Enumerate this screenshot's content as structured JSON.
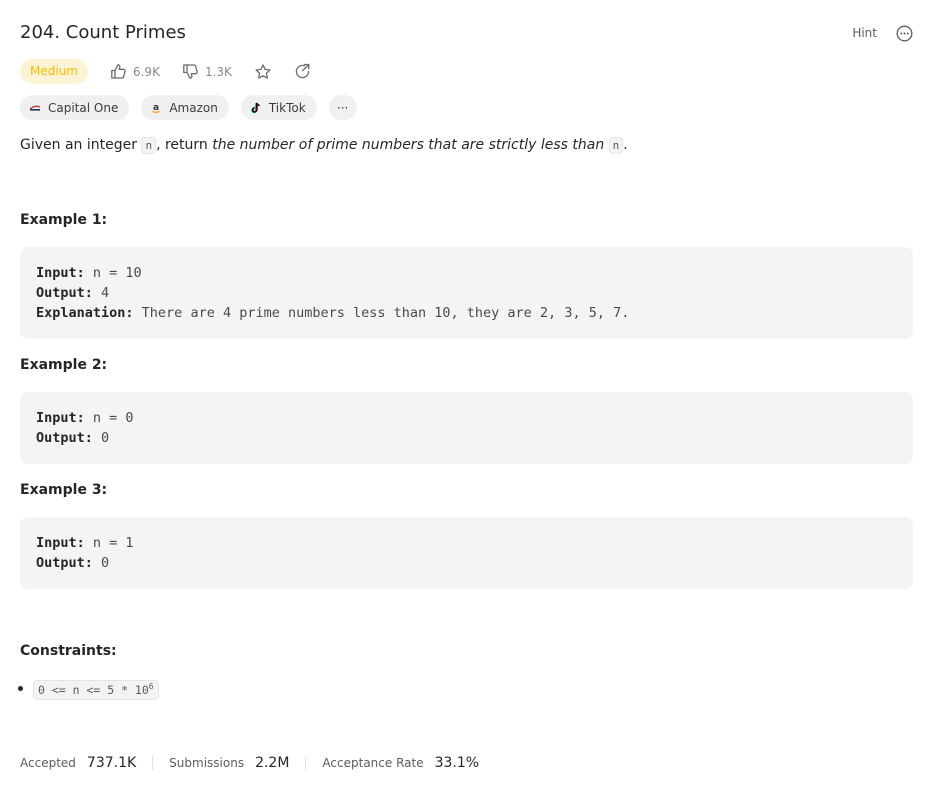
{
  "problem": {
    "title": "204. Count Primes",
    "difficulty": "Medium",
    "likes": "6.9K",
    "dislikes": "1.3K"
  },
  "header": {
    "hint_label": "Hint"
  },
  "companies": [
    {
      "name": "Capital One",
      "icon": "capital-one-logo"
    },
    {
      "name": "Amazon",
      "icon": "amazon-logo"
    },
    {
      "name": "TikTok",
      "icon": "tiktok-logo"
    }
  ],
  "more_label": "···",
  "description": {
    "p1": "Given an integer ",
    "code1": "n",
    "p2": ", return ",
    "em": "the number of prime numbers that are strictly less than",
    "p3": " ",
    "code2": "n",
    "p4": "."
  },
  "examples": [
    {
      "title": "Example 1:",
      "input_label": "Input:",
      "input": " n = 10",
      "output_label": "Output:",
      "output": " 4",
      "explanation_label": "Explanation:",
      "explanation": " There are 4 prime numbers less than 10, they are 2, 3, 5, 7."
    },
    {
      "title": "Example 2:",
      "input_label": "Input:",
      "input": " n = 0",
      "output_label": "Output:",
      "output": " 0"
    },
    {
      "title": "Example 3:",
      "input_label": "Input:",
      "input": " n = 1",
      "output_label": "Output:",
      "output": " 0"
    }
  ],
  "constraints": {
    "title": "Constraints:",
    "items": [
      {
        "text": "0 <= n <= 5 * 10",
        "sup": "6"
      }
    ]
  },
  "stats": {
    "accepted_label": "Accepted",
    "accepted": "737.1K",
    "submissions_label": "Submissions",
    "submissions": "2.2M",
    "rate_label": "Acceptance Rate",
    "rate": "33.1%"
  },
  "colors": {
    "difficulty_text": "#ffb800",
    "difficulty_bg": "#fdf4d6",
    "code_bg": "#f4f4f4"
  }
}
